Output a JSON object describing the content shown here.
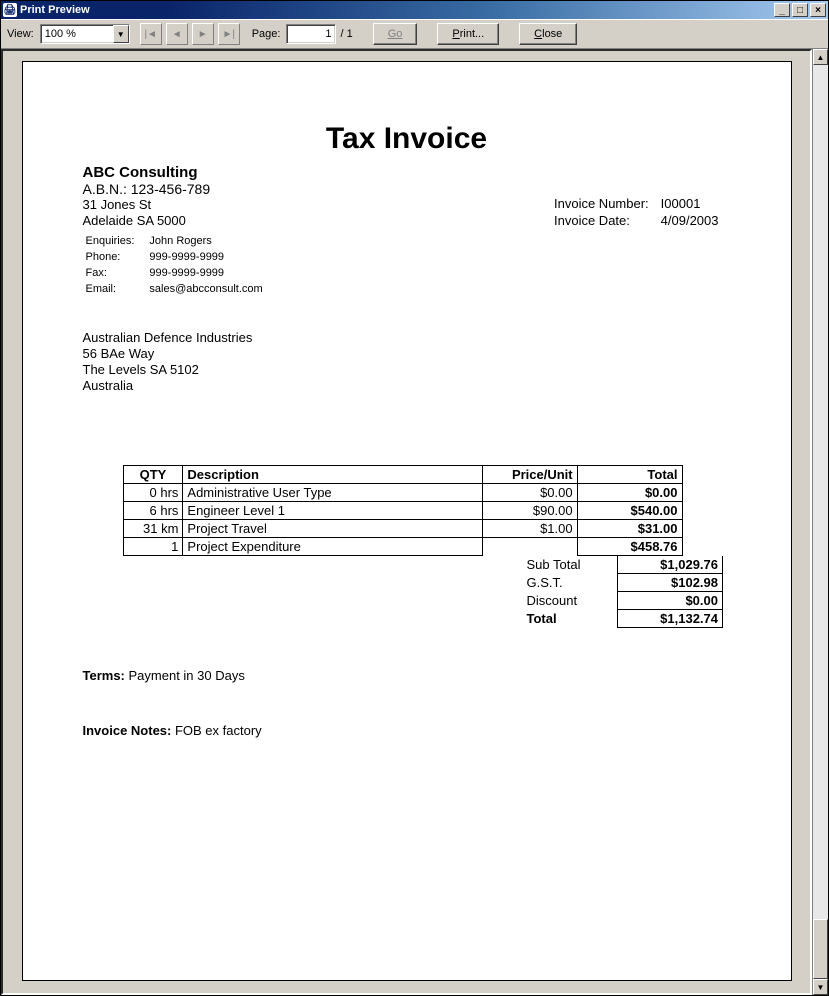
{
  "window": {
    "title": "Print Preview"
  },
  "toolbar": {
    "view_label": "View:",
    "zoom": "100 %",
    "page_label": "Page:",
    "page_current": "1",
    "page_total": "/ 1",
    "go_label": "Go",
    "print_label": "Print...",
    "close_label": "Close"
  },
  "doc": {
    "title": "Tax Invoice",
    "company": "ABC Consulting",
    "abn": "A.B.N.: 123-456-789",
    "addr1": "31 Jones St",
    "addr2": "Adelaide SA 5000",
    "contacts": {
      "enquiries_label": "Enquiries:",
      "enquiries": "John Rogers",
      "phone_label": "Phone:",
      "phone": "999-9999-9999",
      "fax_label": "Fax:",
      "fax": "999-9999-9999",
      "email_label": "Email:",
      "email": "sales@abcconsult.com"
    },
    "meta": {
      "invno_label": "Invoice Number:",
      "invno": "I00001",
      "invdate_label": "Invoice Date:",
      "invdate": "4/09/2003"
    },
    "client": {
      "name": "Australian Defence Industries",
      "addr1": "56 BAe Way",
      "addr2": "The Levels SA 5102",
      "country": "Australia"
    },
    "table": {
      "h_qty": "QTY",
      "h_desc": "Description",
      "h_price": "Price/Unit",
      "h_total": "Total",
      "rows": [
        {
          "qty": "0 hrs",
          "desc": "Administrative User Type",
          "price": "$0.00",
          "total": "$0.00"
        },
        {
          "qty": "6 hrs",
          "desc": "Engineer Level 1",
          "price": "$90.00",
          "total": "$540.00"
        },
        {
          "qty": "31 km",
          "desc": "Project Travel",
          "price": "$1.00",
          "total": "$31.00"
        },
        {
          "qty": "1",
          "desc": "Project Expenditure",
          "price": "",
          "total": "$458.76"
        }
      ]
    },
    "totals": {
      "subtotal_label": "Sub Total",
      "subtotal": "$1,029.76",
      "gst_label": "G.S.T.",
      "gst": "$102.98",
      "discount_label": "Discount",
      "discount": "$0.00",
      "total_label": "Total",
      "total": "$1,132.74"
    },
    "terms_label": "Terms:",
    "terms": " Payment in 30 Days",
    "notes_label": "Invoice Notes:",
    "notes": " FOB ex factory"
  }
}
